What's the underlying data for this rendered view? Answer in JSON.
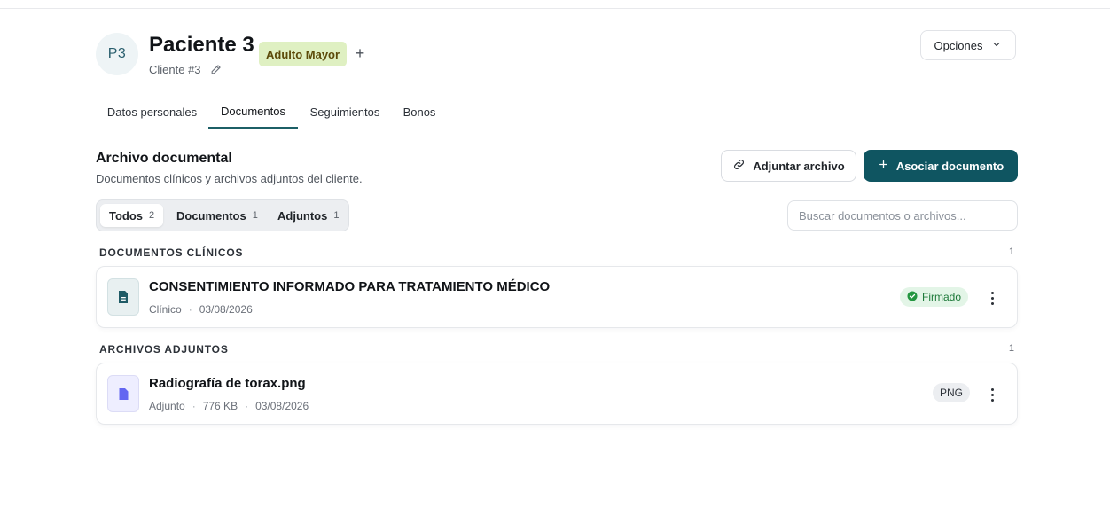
{
  "header": {
    "avatar_initials": "P3",
    "patient_name": "Paciente 3",
    "client_label": "Cliente #3",
    "tag_label": "Adulto Mayor",
    "add_tag_symbol": "+",
    "options_label": "Opciones"
  },
  "tabs": [
    {
      "label": "Datos personales",
      "active": false
    },
    {
      "label": "Documentos",
      "active": true
    },
    {
      "label": "Seguimientos",
      "active": false
    },
    {
      "label": "Bonos",
      "active": false
    }
  ],
  "section": {
    "title": "Archivo documental",
    "subtitle": "Documentos clínicos y archivos adjuntos del cliente.",
    "attach_button": "Adjuntar archivo",
    "associate_button": "Asociar documento"
  },
  "filters": [
    {
      "label": "Todos",
      "count": "2",
      "active": true
    },
    {
      "label": "Documentos",
      "count": "1",
      "active": false
    },
    {
      "label": "Adjuntos",
      "count": "1",
      "active": false
    }
  ],
  "search": {
    "placeholder": "Buscar documentos o archivos...",
    "value": ""
  },
  "groups": {
    "clinical": {
      "label": "DOCUMENTOS CLÍNICOS",
      "count": "1",
      "items": [
        {
          "title": "CONSENTIMIENTO INFORMADO PARA TRATAMIENTO MÉDICO",
          "type": "Clínico",
          "date": "03/08/2026",
          "status": "Firmado"
        }
      ]
    },
    "attachments": {
      "label": "ARCHIVOS ADJUNTOS",
      "count": "1",
      "items": [
        {
          "title": "Radiografía de torax.png",
          "type": "Adjunto",
          "size": "776 KB",
          "date": "03/08/2026",
          "format": "PNG"
        }
      ]
    }
  },
  "meta_separator": "·",
  "colors": {
    "primary": "#0f5561",
    "tag_bg": "#dff0c2",
    "signed_green": "#1e7a3a",
    "attachment_icon": "#6366f1"
  }
}
